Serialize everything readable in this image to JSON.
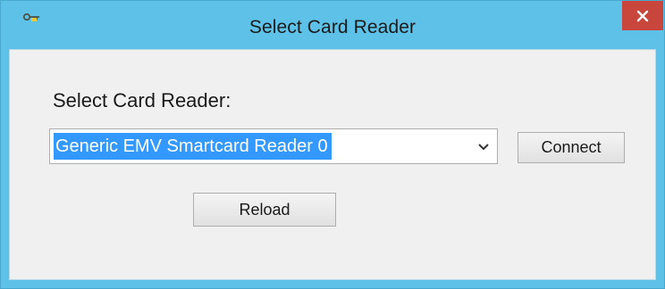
{
  "window": {
    "title": "Select Card Reader",
    "close_glyph": "✕",
    "icon": "key-icon",
    "titlebar_color": "#5ec2e8",
    "close_color": "#c9463d"
  },
  "form": {
    "prompt_label": "Select Card Reader:",
    "reader_select": {
      "selected_value": "Generic EMV Smartcard Reader 0",
      "selection_color": "#3399ff"
    },
    "connect_label": "Connect",
    "reload_label": "Reload"
  }
}
